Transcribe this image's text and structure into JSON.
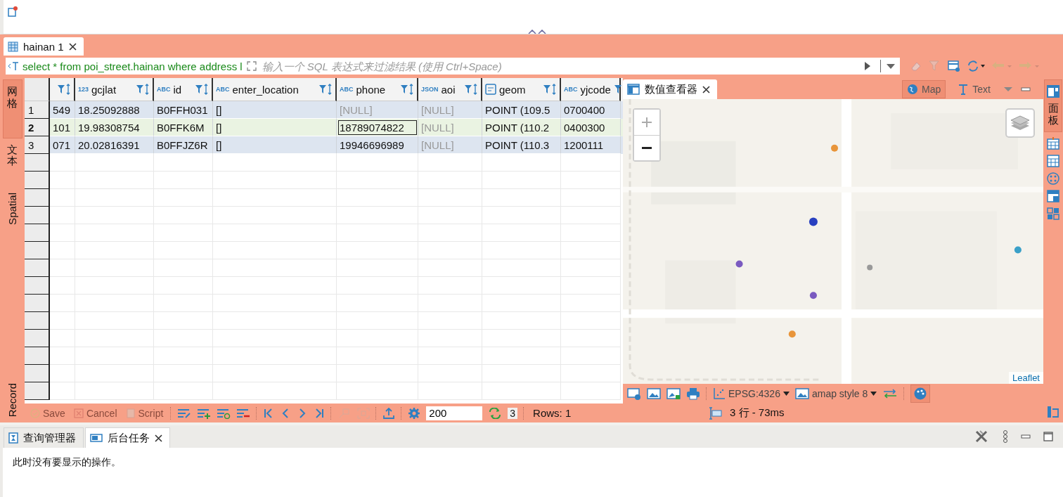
{
  "editor_tab": {
    "label": "hainan 1",
    "selected": true
  },
  "filter": {
    "query": "select * from poi_street.hainan where address l",
    "placeholder": "输入一个 SQL 表达式来过滤结果 (使用 Ctrl+Space)"
  },
  "side_tabs": [
    {
      "label": "网格",
      "kind": "cjk",
      "selected": true
    },
    {
      "label": "文本",
      "kind": "cjk",
      "selected": false
    },
    {
      "label": "Spatial",
      "kind": "latin",
      "selected": false
    },
    {
      "label": "Record",
      "kind": "latin",
      "selected": false
    }
  ],
  "columns": [
    {
      "kind": "cut"
    },
    {
      "kind": "typed",
      "badge": "123",
      "name": "gcjlat"
    },
    {
      "kind": "typed",
      "badge": "ABC",
      "name": "id"
    },
    {
      "kind": "typed",
      "badge": "ABC",
      "name": "enter_location"
    },
    {
      "kind": "typed",
      "badge": "ABC",
      "name": "phone"
    },
    {
      "kind": "typed",
      "badge": "JSON",
      "name": "aoi"
    },
    {
      "kind": "geometry",
      "name": "geom"
    },
    {
      "kind": "typed",
      "badge": "ABC",
      "name": "yjcode"
    }
  ],
  "rows": [
    {
      "number": "1",
      "selected": false,
      "cells": [
        {
          "text": "549",
          "kind": "value",
          "focused": false
        },
        {
          "text": "18.25092888",
          "kind": "value",
          "focused": false
        },
        {
          "text": "B0FFH031",
          "kind": "value",
          "focused": false
        },
        {
          "text": "[]",
          "kind": "value",
          "focused": false
        },
        {
          "text": "[NULL]",
          "kind": "null",
          "focused": false
        },
        {
          "text": "[NULL]",
          "kind": "null",
          "focused": false
        },
        {
          "text": "POINT (109.5",
          "kind": "value",
          "focused": false
        },
        {
          "text": "0700400",
          "kind": "value",
          "focused": false
        }
      ]
    },
    {
      "number": "2",
      "selected": true,
      "cells": [
        {
          "text": "101",
          "kind": "value",
          "focused": false
        },
        {
          "text": "19.98308754",
          "kind": "value",
          "focused": false
        },
        {
          "text": "B0FFK6M",
          "kind": "value",
          "focused": false
        },
        {
          "text": "[]",
          "kind": "value",
          "focused": false
        },
        {
          "text": "18789074822",
          "kind": "value",
          "focused": true
        },
        {
          "text": "[NULL]",
          "kind": "null",
          "focused": false
        },
        {
          "text": "POINT (110.2",
          "kind": "value",
          "focused": false
        },
        {
          "text": "0400300",
          "kind": "value",
          "focused": false
        }
      ]
    },
    {
      "number": "3",
      "selected": false,
      "cells": [
        {
          "text": "071",
          "kind": "value",
          "focused": false
        },
        {
          "text": "20.02816391",
          "kind": "value",
          "focused": false
        },
        {
          "text": "B0FFJZ6R",
          "kind": "value",
          "focused": false
        },
        {
          "text": "[]",
          "kind": "value",
          "focused": false
        },
        {
          "text": "19946696989",
          "kind": "value",
          "focused": false
        },
        {
          "text": "[NULL]",
          "kind": "null",
          "focused": false
        },
        {
          "text": "POINT (110.3",
          "kind": "value",
          "focused": false
        },
        {
          "text": "1200111",
          "kind": "value",
          "focused": false
        }
      ]
    }
  ],
  "grid_toolbar": {
    "actions": [
      {
        "label": "Save",
        "disabled": true
      },
      {
        "label": "Cancel",
        "disabled": true
      },
      {
        "label": "Script",
        "disabled": true
      }
    ],
    "fetch_size": "200",
    "refresh_count": "3",
    "rows": "Rows: 1"
  },
  "value_viewer": {
    "tab": "数值查看器",
    "modes": [
      {
        "label": "Map",
        "selected": true
      },
      {
        "label": "Text",
        "selected": false
      }
    ],
    "attribution": "Leaflet",
    "crs": "EPSG:4326",
    "basemap": "amap style 8",
    "status": "3 行 - 73ms"
  },
  "right_strip": {
    "label": "面板"
  },
  "bottom_panel": {
    "tabs": [
      {
        "label": "查询管理器",
        "selected": false,
        "closable": false
      },
      {
        "label": "后台任务",
        "selected": true,
        "closable": true
      }
    ],
    "message": "此时没有要显示的操作。"
  }
}
